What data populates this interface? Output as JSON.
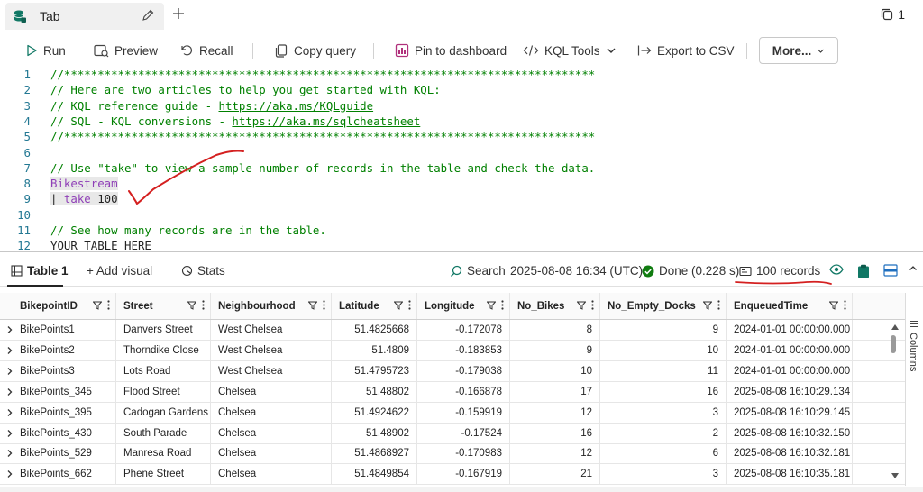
{
  "tab": {
    "label": "Tab",
    "count": "1"
  },
  "toolbar": {
    "run": "Run",
    "preview": "Preview",
    "recall": "Recall",
    "copy_query": "Copy query",
    "pin": "Pin to dashboard",
    "kql_tools": "KQL Tools",
    "export": "Export to CSV",
    "more": "More..."
  },
  "editor": {
    "lines": [
      {
        "n": "1",
        "parts": [
          {
            "t": "//*******************************************************************************",
            "c": "cmt"
          }
        ]
      },
      {
        "n": "2",
        "parts": [
          {
            "t": "// Here are two articles to help you get started with KQL:",
            "c": "cmt"
          }
        ]
      },
      {
        "n": "3",
        "parts": [
          {
            "t": "// KQL reference guide - ",
            "c": "cmt"
          },
          {
            "t": "https://aka.ms/KQLguide",
            "c": "cmt-link"
          }
        ]
      },
      {
        "n": "4",
        "parts": [
          {
            "t": "// SQL - KQL conversions - ",
            "c": "cmt"
          },
          {
            "t": "https://aka.ms/sqlcheatsheet",
            "c": "cmt-link"
          }
        ]
      },
      {
        "n": "5",
        "parts": [
          {
            "t": "//*******************************************************************************",
            "c": "cmt"
          }
        ]
      },
      {
        "n": "6",
        "parts": []
      },
      {
        "n": "7",
        "parts": [
          {
            "t": "// Use \"take\" to view a sample number of records in the table and check the data.",
            "c": "cmt"
          }
        ]
      },
      {
        "n": "8",
        "parts": [
          {
            "t": "Bikestream",
            "c": "tbl hl"
          }
        ]
      },
      {
        "n": "9",
        "parts": [
          {
            "t": "| ",
            "c": "plain hl"
          },
          {
            "t": "take",
            "c": "tbl hl"
          },
          {
            "t": " 100",
            "c": "plain hl"
          }
        ]
      },
      {
        "n": "10",
        "parts": []
      },
      {
        "n": "11",
        "parts": [
          {
            "t": "// See how many records are in the table.",
            "c": "cmt"
          }
        ]
      },
      {
        "n": "12",
        "parts": [
          {
            "t": "YOUR_TABLE_HERE",
            "c": "plain"
          }
        ]
      }
    ]
  },
  "results": {
    "table_tab": "Table 1",
    "add_visual": "+ Add visual",
    "stats": "Stats",
    "search": "Search",
    "timestamp": "2025-08-08 16:34 (UTC)",
    "done": "Done (0.228 s)",
    "records": "100 records"
  },
  "grid": {
    "columns": [
      "BikepointID",
      "Street",
      "Neighbourhood",
      "Latitude",
      "Longitude",
      "No_Bikes",
      "No_Empty_Docks",
      "EnqueuedTime"
    ],
    "rows": [
      [
        "BikePoints1",
        "Danvers Street",
        "West Chelsea",
        "51.4825668",
        "-0.172078",
        "8",
        "9",
        "2024-01-01 00:00:00.000"
      ],
      [
        "BikePoints2",
        "Thorndike Close",
        "West Chelsea",
        "51.4809",
        "-0.183853",
        "9",
        "10",
        "2024-01-01 00:00:00.000"
      ],
      [
        "BikePoints3",
        "Lots Road",
        "West Chelsea",
        "51.4795723",
        "-0.179038",
        "10",
        "11",
        "2024-01-01 00:00:00.000"
      ],
      [
        "BikePoints_345",
        "Flood Street",
        "Chelsea",
        "51.48802",
        "-0.166878",
        "17",
        "16",
        "2025-08-08 16:10:29.134"
      ],
      [
        "BikePoints_395",
        "Cadogan Gardens",
        "Chelsea",
        "51.4924622",
        "-0.159919",
        "12",
        "3",
        "2025-08-08 16:10:29.145"
      ],
      [
        "BikePoints_430",
        "South Parade",
        "Chelsea",
        "51.48902",
        "-0.17524",
        "16",
        "2",
        "2025-08-08 16:10:32.150"
      ],
      [
        "BikePoints_529",
        "Manresa Road",
        "Chelsea",
        "51.4868927",
        "-0.170983",
        "12",
        "6",
        "2025-08-08 16:10:32.181"
      ],
      [
        "BikePoints_662",
        "Phene Street",
        "Chelsea",
        "51.4849854",
        "-0.167919",
        "21",
        "3",
        "2025-08-08 16:10:35.181"
      ]
    ]
  },
  "side_panel": {
    "columns_label": "Columns"
  },
  "colors": {
    "accent_teal": "#117865",
    "annotation_red": "#d42020",
    "done_green": "#107c10"
  }
}
